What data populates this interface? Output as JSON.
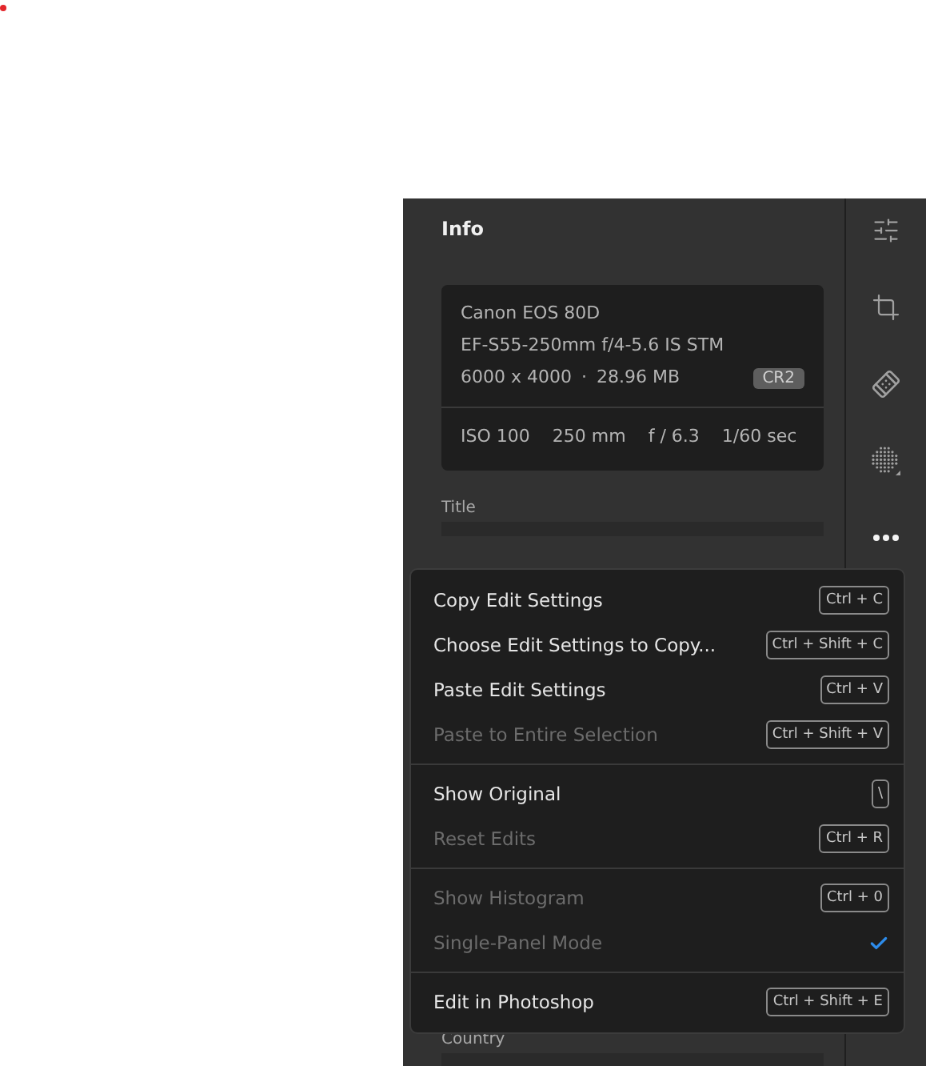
{
  "panel": {
    "title": "Info",
    "camera": {
      "model": "Canon EOS 80D",
      "lens": "EF-S55-250mm f/4-5.6 IS STM",
      "dimensions": "6000 x 4000",
      "separator": "·",
      "size": "28.96 MB",
      "format": "CR2",
      "exposure": [
        "ISO 100",
        "250 mm",
        "f / 6.3",
        "1/60 sec"
      ]
    },
    "fields": [
      {
        "label": "Title"
      },
      {
        "label": "Country"
      }
    ]
  },
  "toolbar": [
    {
      "kind": "sliders",
      "selected": false
    },
    {
      "kind": "crop",
      "selected": false
    },
    {
      "kind": "heal",
      "selected": false
    },
    {
      "kind": "mask",
      "selected": false
    },
    {
      "kind": "more",
      "selected": true
    }
  ],
  "menu": {
    "groups": [
      [
        {
          "label": "Copy Edit Settings",
          "shortcut": "Ctrl + C",
          "disabled": false,
          "checked": false
        },
        {
          "label": "Choose Edit Settings to Copy...",
          "shortcut": "Ctrl + Shift + C",
          "disabled": false,
          "checked": false
        },
        {
          "label": "Paste Edit Settings",
          "shortcut": "Ctrl + V",
          "disabled": false,
          "checked": false
        },
        {
          "label": "Paste to Entire Selection",
          "shortcut": "Ctrl + Shift + V",
          "disabled": true,
          "checked": false
        }
      ],
      [
        {
          "label": "Show Original",
          "shortcut": "\\",
          "disabled": false,
          "checked": false
        },
        {
          "label": "Reset Edits",
          "shortcut": "Ctrl + R",
          "disabled": true,
          "checked": false
        }
      ],
      [
        {
          "label": "Show Histogram",
          "shortcut": "Ctrl + 0",
          "disabled": true,
          "checked": false
        },
        {
          "label": "Single-Panel Mode",
          "disabled": true,
          "checked": true
        }
      ],
      [
        {
          "label": "Edit in Photoshop",
          "shortcut": "Ctrl + Shift + E",
          "disabled": false,
          "checked": false
        }
      ]
    ]
  }
}
